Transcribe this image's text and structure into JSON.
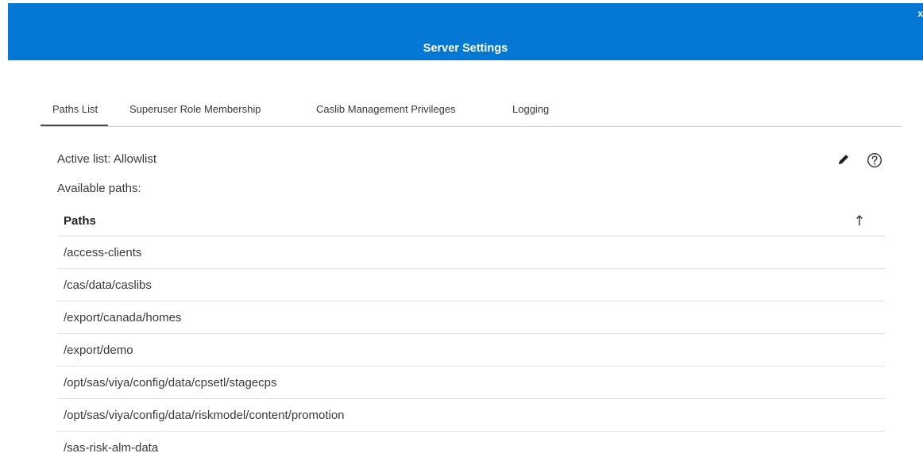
{
  "dialog": {
    "title": "Server Settings",
    "close_glyph": "x"
  },
  "tabs": [
    {
      "label": "Paths List",
      "active": true
    },
    {
      "label": "Superuser Role Membership",
      "active": false
    },
    {
      "label": "Caslib Management Privileges",
      "active": false
    },
    {
      "label": "Logging",
      "active": false
    }
  ],
  "content": {
    "active_list": "Active list: Allowlist",
    "available_paths": "Available paths:",
    "icons": {
      "edit": "pencil-icon",
      "help": "help-circle-icon",
      "sort": "arrow-up-icon"
    }
  },
  "table": {
    "header": "Paths",
    "rows": [
      "/access-clients",
      "/cas/data/caslibs",
      "/export/canada/homes",
      "/export/demo",
      "/opt/sas/viya/config/data/cpsetl/stagecps",
      "/opt/sas/viya/config/data/riskmodel/content/promotion",
      "/sas-risk-alm-data"
    ]
  },
  "colors": {
    "header_blue": "#0478d4",
    "text": "#3a3a3a",
    "divider": "#d8d8d8"
  }
}
